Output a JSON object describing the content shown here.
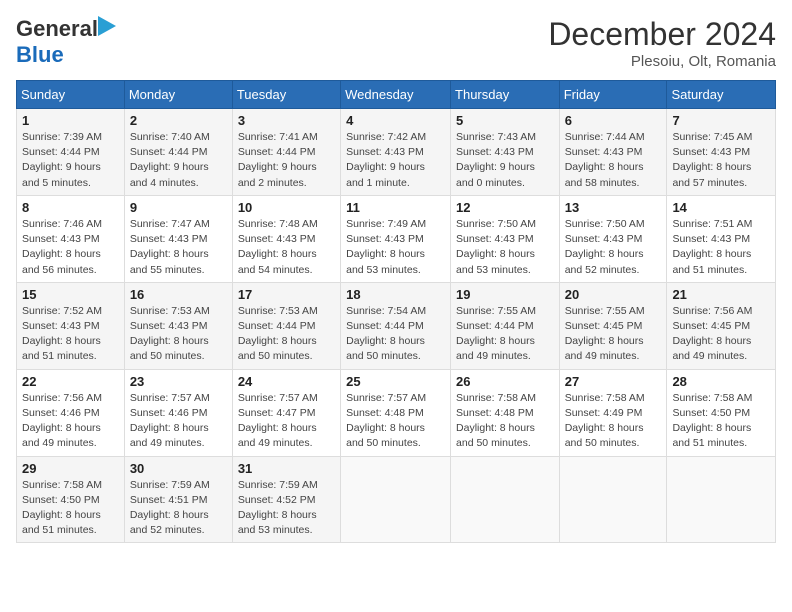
{
  "header": {
    "logo_general": "General",
    "logo_blue": "Blue",
    "title": "December 2024",
    "subtitle": "Plesoiu, Olt, Romania"
  },
  "days_of_week": [
    "Sunday",
    "Monday",
    "Tuesday",
    "Wednesday",
    "Thursday",
    "Friday",
    "Saturday"
  ],
  "weeks": [
    [
      {
        "day": 1,
        "sunrise": "7:39 AM",
        "sunset": "4:44 PM",
        "daylight": "9 hours and 5 minutes."
      },
      {
        "day": 2,
        "sunrise": "7:40 AM",
        "sunset": "4:44 PM",
        "daylight": "9 hours and 4 minutes."
      },
      {
        "day": 3,
        "sunrise": "7:41 AM",
        "sunset": "4:44 PM",
        "daylight": "9 hours and 2 minutes."
      },
      {
        "day": 4,
        "sunrise": "7:42 AM",
        "sunset": "4:43 PM",
        "daylight": "9 hours and 1 minute."
      },
      {
        "day": 5,
        "sunrise": "7:43 AM",
        "sunset": "4:43 PM",
        "daylight": "9 hours and 0 minutes."
      },
      {
        "day": 6,
        "sunrise": "7:44 AM",
        "sunset": "4:43 PM",
        "daylight": "8 hours and 58 minutes."
      },
      {
        "day": 7,
        "sunrise": "7:45 AM",
        "sunset": "4:43 PM",
        "daylight": "8 hours and 57 minutes."
      }
    ],
    [
      {
        "day": 8,
        "sunrise": "7:46 AM",
        "sunset": "4:43 PM",
        "daylight": "8 hours and 56 minutes."
      },
      {
        "day": 9,
        "sunrise": "7:47 AM",
        "sunset": "4:43 PM",
        "daylight": "8 hours and 55 minutes."
      },
      {
        "day": 10,
        "sunrise": "7:48 AM",
        "sunset": "4:43 PM",
        "daylight": "8 hours and 54 minutes."
      },
      {
        "day": 11,
        "sunrise": "7:49 AM",
        "sunset": "4:43 PM",
        "daylight": "8 hours and 53 minutes."
      },
      {
        "day": 12,
        "sunrise": "7:50 AM",
        "sunset": "4:43 PM",
        "daylight": "8 hours and 53 minutes."
      },
      {
        "day": 13,
        "sunrise": "7:50 AM",
        "sunset": "4:43 PM",
        "daylight": "8 hours and 52 minutes."
      },
      {
        "day": 14,
        "sunrise": "7:51 AM",
        "sunset": "4:43 PM",
        "daylight": "8 hours and 51 minutes."
      }
    ],
    [
      {
        "day": 15,
        "sunrise": "7:52 AM",
        "sunset": "4:43 PM",
        "daylight": "8 hours and 51 minutes."
      },
      {
        "day": 16,
        "sunrise": "7:53 AM",
        "sunset": "4:43 PM",
        "daylight": "8 hours and 50 minutes."
      },
      {
        "day": 17,
        "sunrise": "7:53 AM",
        "sunset": "4:44 PM",
        "daylight": "8 hours and 50 minutes."
      },
      {
        "day": 18,
        "sunrise": "7:54 AM",
        "sunset": "4:44 PM",
        "daylight": "8 hours and 50 minutes."
      },
      {
        "day": 19,
        "sunrise": "7:55 AM",
        "sunset": "4:44 PM",
        "daylight": "8 hours and 49 minutes."
      },
      {
        "day": 20,
        "sunrise": "7:55 AM",
        "sunset": "4:45 PM",
        "daylight": "8 hours and 49 minutes."
      },
      {
        "day": 21,
        "sunrise": "7:56 AM",
        "sunset": "4:45 PM",
        "daylight": "8 hours and 49 minutes."
      }
    ],
    [
      {
        "day": 22,
        "sunrise": "7:56 AM",
        "sunset": "4:46 PM",
        "daylight": "8 hours and 49 minutes."
      },
      {
        "day": 23,
        "sunrise": "7:57 AM",
        "sunset": "4:46 PM",
        "daylight": "8 hours and 49 minutes."
      },
      {
        "day": 24,
        "sunrise": "7:57 AM",
        "sunset": "4:47 PM",
        "daylight": "8 hours and 49 minutes."
      },
      {
        "day": 25,
        "sunrise": "7:57 AM",
        "sunset": "4:48 PM",
        "daylight": "8 hours and 50 minutes."
      },
      {
        "day": 26,
        "sunrise": "7:58 AM",
        "sunset": "4:48 PM",
        "daylight": "8 hours and 50 minutes."
      },
      {
        "day": 27,
        "sunrise": "7:58 AM",
        "sunset": "4:49 PM",
        "daylight": "8 hours and 50 minutes."
      },
      {
        "day": 28,
        "sunrise": "7:58 AM",
        "sunset": "4:50 PM",
        "daylight": "8 hours and 51 minutes."
      }
    ],
    [
      {
        "day": 29,
        "sunrise": "7:58 AM",
        "sunset": "4:50 PM",
        "daylight": "8 hours and 51 minutes."
      },
      {
        "day": 30,
        "sunrise": "7:59 AM",
        "sunset": "4:51 PM",
        "daylight": "8 hours and 52 minutes."
      },
      {
        "day": 31,
        "sunrise": "7:59 AM",
        "sunset": "4:52 PM",
        "daylight": "8 hours and 53 minutes."
      },
      null,
      null,
      null,
      null
    ]
  ]
}
